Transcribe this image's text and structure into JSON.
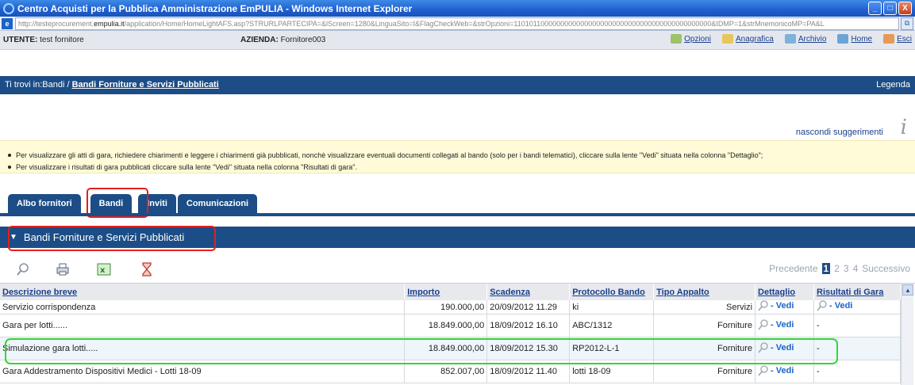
{
  "window": {
    "title": "Centro Acquisti per la Pubblica Amministrazione EmPULIA - Windows Internet Explorer",
    "minimize_label": "_",
    "maximize_label": "□",
    "close_label": "X"
  },
  "address": {
    "url_prefix": "http://testeprocurement.",
    "url_host": "empulia.it",
    "url_rest": "/application/Home/HomeLightAFS.asp?STRURLPARTECIPA=&lScreen=1280&LinguaSito=I&FlagCheckWeb=&strOpzioni=11010110000000000000000000000000000000000000000000&IDMP=1&strMnemonicoMP=PA&L"
  },
  "userbar": {
    "utente_label": "UTENTE:",
    "utente_value": "test fornitore",
    "azienda_label": "AZIENDA:",
    "azienda_value": "Fornitore003",
    "links": [
      "Opzioni",
      "Anagrafica",
      "Archivio",
      "Home",
      "Esci"
    ]
  },
  "crumbbar": {
    "prefix": "Ti trovi in:Bandi / ",
    "current": "Bandi Forniture e Servizi Pubblicati",
    "legenda": "Legenda"
  },
  "suggestions": {
    "hide_label": "nascondi suggerimenti",
    "info_glyph": "i",
    "line1": "Per visualizzare gli atti di gara, richiedere chiarimenti e leggere i chiarimenti già pubblicati, nonchè visualizzare eventuali documenti collegati al bando (solo per i bandi telematici), cliccare sulla lente \"Vedi\" situata nella colonna \"Dettaglio\";",
    "line2": "Per visualizzare i risultati di gara pubblicati cliccare sulla lente \"Vedi\" situata nella colonna \"Risultati di gara\"."
  },
  "tabs": [
    {
      "label": "Albo fornitori"
    },
    {
      "label": "Bandi"
    },
    {
      "label": "Inviti"
    },
    {
      "label": "Comunicazioni"
    }
  ],
  "section": {
    "title": "Bandi Forniture e Servizi Pubblicati"
  },
  "pager": {
    "prev": "Precedente",
    "pages": [
      "1",
      "2",
      "3",
      "4"
    ],
    "current": "1",
    "next": "Successivo"
  },
  "table": {
    "headers": [
      "Descrizione breve",
      "Importo",
      "Scadenza",
      "Protocollo Bando",
      "Tipo Appalto",
      "Dettaglio",
      "Risultati di Gara"
    ],
    "rows": [
      {
        "descr": "Servizio corrispondenza",
        "importo": "190.000,00",
        "scadenza": "20/09/2012 11.29",
        "protocollo": "ki",
        "tipo": "Servizi",
        "dettaglio": "- Vedi",
        "risultati": "- Vedi"
      },
      {
        "descr": "Gara per lotti......",
        "importo": "18.849.000,00",
        "scadenza": "18/09/2012 16.10",
        "protocollo": "ABC/1312",
        "tipo": "Forniture",
        "dettaglio": "- Vedi",
        "risultati": "-"
      },
      {
        "descr": "Simulazione gara lotti.....",
        "importo": "18.849.000,00",
        "scadenza": "18/09/2012 15.30",
        "protocollo": "RP2012-L-1",
        "tipo": "Forniture",
        "dettaglio": "- Vedi",
        "risultati": "-"
      },
      {
        "descr": "Gara Addestramento Dispositivi Medici - Lotti 18-09",
        "importo": "852.007,00",
        "scadenza": "18/09/2012 11.40",
        "protocollo": "lotti 18-09",
        "tipo": "Forniture",
        "dettaglio": "- Vedi",
        "risultati": "-"
      }
    ]
  },
  "colors": {
    "navy": "#1c4d86",
    "highlight_red": "#e02020",
    "highlight_green": "#34d634",
    "suggest_bg": "#fffbd8"
  }
}
